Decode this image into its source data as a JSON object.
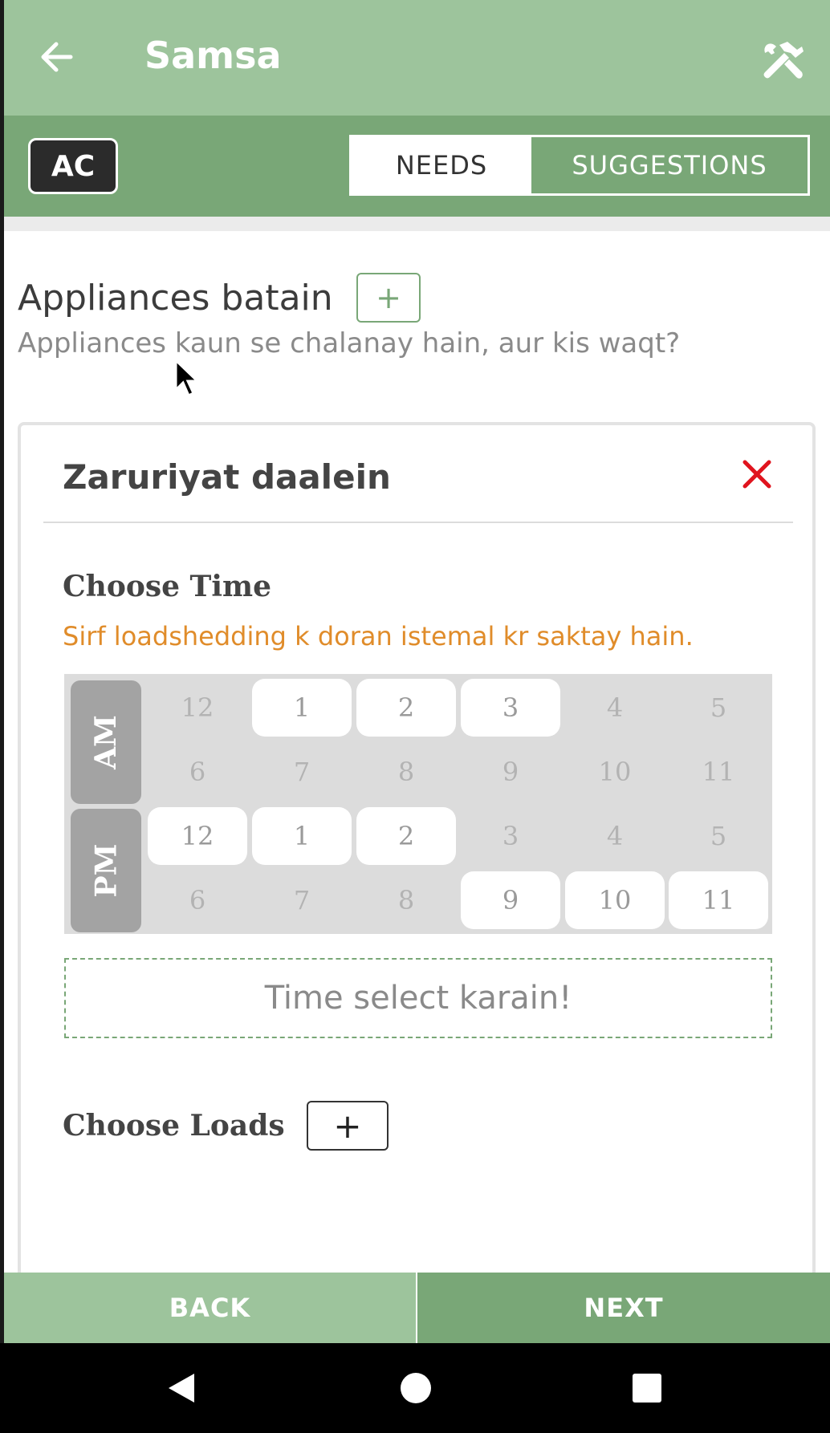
{
  "appbar": {
    "title": "Samsa",
    "back_icon": "arrow-left-icon",
    "tools_icon": "hammer-wrench-icon"
  },
  "subbar": {
    "badge": "AC",
    "tabs": [
      {
        "label": "NEEDS",
        "active": true
      },
      {
        "label": "SUGGESTIONS",
        "active": false
      }
    ]
  },
  "section": {
    "title": "Appliances batain",
    "add_label": "+",
    "subtitle": "Appliances kaun se chalanay hain, aur kis waqt?"
  },
  "card": {
    "title": "Zaruriyat daalein",
    "close_icon": "close-x-icon",
    "choose_time_label": "Choose Time",
    "hint": "Sirf loadshedding k doran istemal kr saktay hain.",
    "am_label": "AM",
    "pm_label": "PM",
    "am_hours": [
      {
        "label": "12",
        "selected": false
      },
      {
        "label": "1",
        "selected": true
      },
      {
        "label": "2",
        "selected": true
      },
      {
        "label": "3",
        "selected": true
      },
      {
        "label": "4",
        "selected": false
      },
      {
        "label": "5",
        "selected": false
      },
      {
        "label": "6",
        "selected": false
      },
      {
        "label": "7",
        "selected": false
      },
      {
        "label": "8",
        "selected": false
      },
      {
        "label": "9",
        "selected": false
      },
      {
        "label": "10",
        "selected": false
      },
      {
        "label": "11",
        "selected": false
      }
    ],
    "pm_hours": [
      {
        "label": "12",
        "selected": true
      },
      {
        "label": "1",
        "selected": true
      },
      {
        "label": "2",
        "selected": true
      },
      {
        "label": "3",
        "selected": false
      },
      {
        "label": "4",
        "selected": false
      },
      {
        "label": "5",
        "selected": false
      },
      {
        "label": "6",
        "selected": false
      },
      {
        "label": "7",
        "selected": false
      },
      {
        "label": "8",
        "selected": false
      },
      {
        "label": "9",
        "selected": true
      },
      {
        "label": "10",
        "selected": true
      },
      {
        "label": "11",
        "selected": true
      }
    ],
    "time_select_text": "Time select karain!",
    "choose_loads_label": "Choose Loads",
    "add_load_label": "+"
  },
  "bottom": {
    "back_label": "BACK",
    "next_label": "NEXT"
  },
  "colors": {
    "appbar": "#9dc49c",
    "subbar": "#79a777",
    "hint": "#e08c2a",
    "close": "#e0141e"
  }
}
